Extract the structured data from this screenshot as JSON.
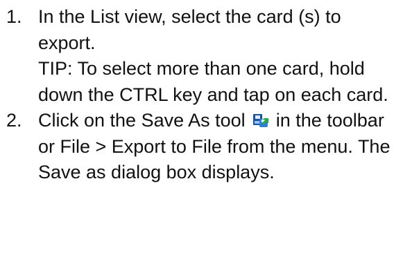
{
  "steps": [
    {
      "number": "1.",
      "text": "In the List view, select the card (s) to export.",
      "tip": "TIP: To select more than one card, hold down the CTRL key and tap on each card."
    },
    {
      "number": "2.",
      "text_before_icon": "Click on the Save As tool",
      "icon": "save-as-icon",
      "text_after_icon": "in the toolbar or File > Export to File from the menu. The Save as dialog box displays."
    }
  ]
}
